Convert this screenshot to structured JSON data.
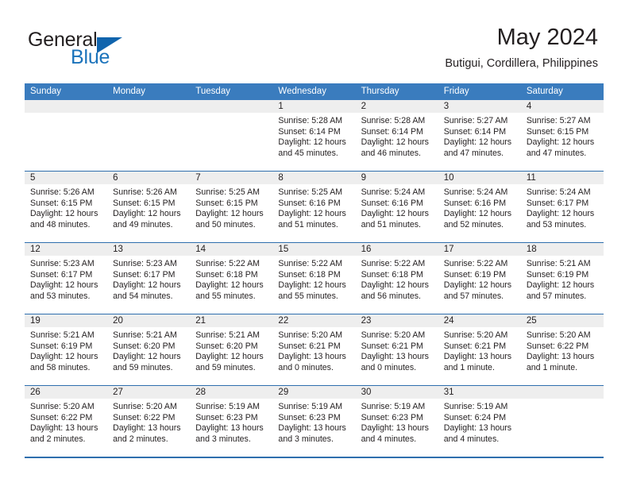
{
  "brand": {
    "name_top": "General",
    "name_bottom": "Blue",
    "triangle_color": "#1064ad",
    "blue_color": "#1b73bb"
  },
  "header": {
    "month_title": "May 2024",
    "location": "Butigui, Cordillera, Philippines"
  },
  "calendar": {
    "header_bg": "#3a7cbe",
    "row_rule_color": "#2f6fae",
    "datestrip_bg": "#eeeeee",
    "weekday_headers": [
      "Sunday",
      "Monday",
      "Tuesday",
      "Wednesday",
      "Thursday",
      "Friday",
      "Saturday"
    ],
    "weeks": [
      [
        {
          "date": "",
          "lines": []
        },
        {
          "date": "",
          "lines": []
        },
        {
          "date": "",
          "lines": []
        },
        {
          "date": "1",
          "lines": [
            "Sunrise: 5:28 AM",
            "Sunset: 6:14 PM",
            "Daylight: 12 hours",
            "and 45 minutes."
          ]
        },
        {
          "date": "2",
          "lines": [
            "Sunrise: 5:28 AM",
            "Sunset: 6:14 PM",
            "Daylight: 12 hours",
            "and 46 minutes."
          ]
        },
        {
          "date": "3",
          "lines": [
            "Sunrise: 5:27 AM",
            "Sunset: 6:14 PM",
            "Daylight: 12 hours",
            "and 47 minutes."
          ]
        },
        {
          "date": "4",
          "lines": [
            "Sunrise: 5:27 AM",
            "Sunset: 6:15 PM",
            "Daylight: 12 hours",
            "and 47 minutes."
          ]
        }
      ],
      [
        {
          "date": "5",
          "lines": [
            "Sunrise: 5:26 AM",
            "Sunset: 6:15 PM",
            "Daylight: 12 hours",
            "and 48 minutes."
          ]
        },
        {
          "date": "6",
          "lines": [
            "Sunrise: 5:26 AM",
            "Sunset: 6:15 PM",
            "Daylight: 12 hours",
            "and 49 minutes."
          ]
        },
        {
          "date": "7",
          "lines": [
            "Sunrise: 5:25 AM",
            "Sunset: 6:15 PM",
            "Daylight: 12 hours",
            "and 50 minutes."
          ]
        },
        {
          "date": "8",
          "lines": [
            "Sunrise: 5:25 AM",
            "Sunset: 6:16 PM",
            "Daylight: 12 hours",
            "and 51 minutes."
          ]
        },
        {
          "date": "9",
          "lines": [
            "Sunrise: 5:24 AM",
            "Sunset: 6:16 PM",
            "Daylight: 12 hours",
            "and 51 minutes."
          ]
        },
        {
          "date": "10",
          "lines": [
            "Sunrise: 5:24 AM",
            "Sunset: 6:16 PM",
            "Daylight: 12 hours",
            "and 52 minutes."
          ]
        },
        {
          "date": "11",
          "lines": [
            "Sunrise: 5:24 AM",
            "Sunset: 6:17 PM",
            "Daylight: 12 hours",
            "and 53 minutes."
          ]
        }
      ],
      [
        {
          "date": "12",
          "lines": [
            "Sunrise: 5:23 AM",
            "Sunset: 6:17 PM",
            "Daylight: 12 hours",
            "and 53 minutes."
          ]
        },
        {
          "date": "13",
          "lines": [
            "Sunrise: 5:23 AM",
            "Sunset: 6:17 PM",
            "Daylight: 12 hours",
            "and 54 minutes."
          ]
        },
        {
          "date": "14",
          "lines": [
            "Sunrise: 5:22 AM",
            "Sunset: 6:18 PM",
            "Daylight: 12 hours",
            "and 55 minutes."
          ]
        },
        {
          "date": "15",
          "lines": [
            "Sunrise: 5:22 AM",
            "Sunset: 6:18 PM",
            "Daylight: 12 hours",
            "and 55 minutes."
          ]
        },
        {
          "date": "16",
          "lines": [
            "Sunrise: 5:22 AM",
            "Sunset: 6:18 PM",
            "Daylight: 12 hours",
            "and 56 minutes."
          ]
        },
        {
          "date": "17",
          "lines": [
            "Sunrise: 5:22 AM",
            "Sunset: 6:19 PM",
            "Daylight: 12 hours",
            "and 57 minutes."
          ]
        },
        {
          "date": "18",
          "lines": [
            "Sunrise: 5:21 AM",
            "Sunset: 6:19 PM",
            "Daylight: 12 hours",
            "and 57 minutes."
          ]
        }
      ],
      [
        {
          "date": "19",
          "lines": [
            "Sunrise: 5:21 AM",
            "Sunset: 6:19 PM",
            "Daylight: 12 hours",
            "and 58 minutes."
          ]
        },
        {
          "date": "20",
          "lines": [
            "Sunrise: 5:21 AM",
            "Sunset: 6:20 PM",
            "Daylight: 12 hours",
            "and 59 minutes."
          ]
        },
        {
          "date": "21",
          "lines": [
            "Sunrise: 5:21 AM",
            "Sunset: 6:20 PM",
            "Daylight: 12 hours",
            "and 59 minutes."
          ]
        },
        {
          "date": "22",
          "lines": [
            "Sunrise: 5:20 AM",
            "Sunset: 6:21 PM",
            "Daylight: 13 hours",
            "and 0 minutes."
          ]
        },
        {
          "date": "23",
          "lines": [
            "Sunrise: 5:20 AM",
            "Sunset: 6:21 PM",
            "Daylight: 13 hours",
            "and 0 minutes."
          ]
        },
        {
          "date": "24",
          "lines": [
            "Sunrise: 5:20 AM",
            "Sunset: 6:21 PM",
            "Daylight: 13 hours",
            "and 1 minute."
          ]
        },
        {
          "date": "25",
          "lines": [
            "Sunrise: 5:20 AM",
            "Sunset: 6:22 PM",
            "Daylight: 13 hours",
            "and 1 minute."
          ]
        }
      ],
      [
        {
          "date": "26",
          "lines": [
            "Sunrise: 5:20 AM",
            "Sunset: 6:22 PM",
            "Daylight: 13 hours",
            "and 2 minutes."
          ]
        },
        {
          "date": "27",
          "lines": [
            "Sunrise: 5:20 AM",
            "Sunset: 6:22 PM",
            "Daylight: 13 hours",
            "and 2 minutes."
          ]
        },
        {
          "date": "28",
          "lines": [
            "Sunrise: 5:19 AM",
            "Sunset: 6:23 PM",
            "Daylight: 13 hours",
            "and 3 minutes."
          ]
        },
        {
          "date": "29",
          "lines": [
            "Sunrise: 5:19 AM",
            "Sunset: 6:23 PM",
            "Daylight: 13 hours",
            "and 3 minutes."
          ]
        },
        {
          "date": "30",
          "lines": [
            "Sunrise: 5:19 AM",
            "Sunset: 6:23 PM",
            "Daylight: 13 hours",
            "and 4 minutes."
          ]
        },
        {
          "date": "31",
          "lines": [
            "Sunrise: 5:19 AM",
            "Sunset: 6:24 PM",
            "Daylight: 13 hours",
            "and 4 minutes."
          ]
        },
        {
          "date": "",
          "lines": []
        }
      ]
    ]
  }
}
